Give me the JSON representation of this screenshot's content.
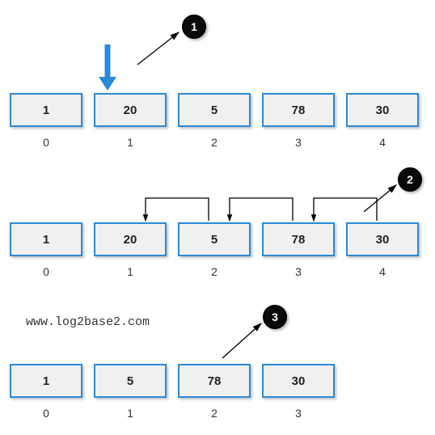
{
  "steps": [
    {
      "badge": "1",
      "array": [
        "1",
        "20",
        "5",
        "78",
        "30"
      ],
      "indices": [
        "0",
        "1",
        "2",
        "3",
        "4"
      ]
    },
    {
      "badge": "2",
      "array": [
        "1",
        "20",
        "5",
        "78",
        "30"
      ],
      "indices": [
        "0",
        "1",
        "2",
        "3",
        "4"
      ]
    },
    {
      "badge": "3",
      "array": [
        "1",
        "5",
        "78",
        "30"
      ],
      "indices": [
        "0",
        "1",
        "2",
        "3"
      ]
    }
  ],
  "watermark": "www.log2base2.com",
  "colors": {
    "cellBorder": "#2a8ad8",
    "arrowBlue": "#2a8ad8",
    "badgeBg": "#0a0a0a"
  }
}
